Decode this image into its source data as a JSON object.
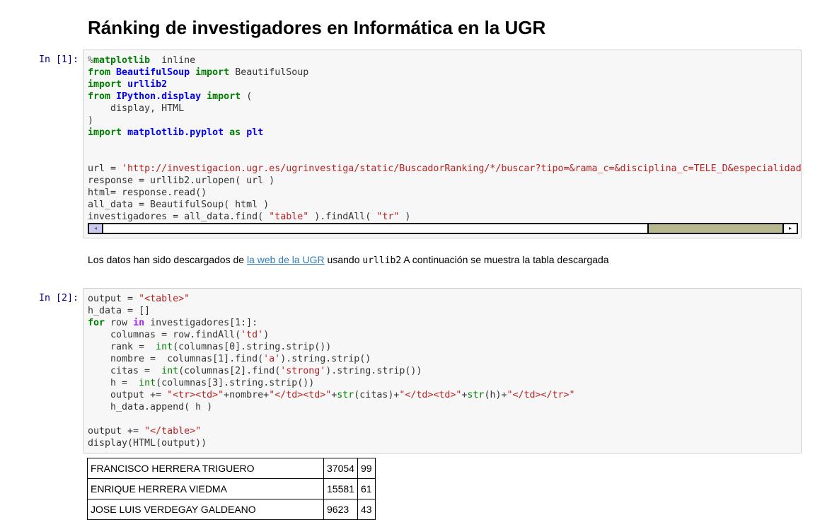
{
  "title": "Ránking de investigadores en Informática en la UGR",
  "cells": [
    {
      "prompt": "In [1]:",
      "lines": [
        [
          [
            "mg",
            "%"
          ],
          [
            "kw",
            "matplotlib"
          ],
          [
            "",
            "  inline"
          ]
        ],
        [
          [
            "kw",
            "from"
          ],
          [
            "",
            " "
          ],
          [
            "nm",
            "BeautifulSoup"
          ],
          [
            "",
            " "
          ],
          [
            "kw",
            "import"
          ],
          [
            "",
            " BeautifulSoup"
          ]
        ],
        [
          [
            "kw",
            "import"
          ],
          [
            "",
            " "
          ],
          [
            "nm",
            "urllib2"
          ]
        ],
        [
          [
            "kw",
            "from"
          ],
          [
            "",
            " "
          ],
          [
            "nm",
            "IPython.display"
          ],
          [
            "",
            " "
          ],
          [
            "kw",
            "import"
          ],
          [
            "",
            " ("
          ]
        ],
        [
          [
            "",
            "    display, HTML"
          ]
        ],
        [
          [
            "",
            ")"
          ]
        ],
        [
          [
            "kw",
            "import"
          ],
          [
            "",
            " "
          ],
          [
            "nm",
            "matplotlib.pyplot"
          ],
          [
            "",
            " "
          ],
          [
            "kw",
            "as"
          ],
          [
            "",
            " "
          ],
          [
            "nm",
            "plt"
          ]
        ],
        [],
        [],
        [
          [
            "",
            "url = "
          ],
          [
            "st",
            "'http://investigacion.ugr.es/ugrinvestiga/static/BuscadorRanking/*/buscar?tipo=&rama_c=&disciplina_c=TELE_D&especialidad"
          ]
        ],
        [
          [
            "",
            "response = urllib2.urlopen( url )"
          ]
        ],
        [
          [
            "",
            "html= response.read()"
          ]
        ],
        [
          [
            "",
            "all_data = BeautifulSoup( html )"
          ]
        ],
        [
          [
            "",
            "investigadores = all_data.find( "
          ],
          [
            "st",
            "\"table\""
          ],
          [
            "",
            " ).findAll( "
          ],
          [
            "st",
            "\"tr\""
          ],
          [
            "",
            " )"
          ]
        ]
      ]
    },
    {
      "prompt": "In [2]:",
      "lines": [
        [
          [
            "",
            "output = "
          ],
          [
            "st",
            "\"<table>\""
          ]
        ],
        [
          [
            "",
            "h_data = []"
          ]
        ],
        [
          [
            "kw",
            "for"
          ],
          [
            "",
            " row "
          ],
          [
            "ow",
            "in"
          ],
          [
            "",
            " investigadores[1:]:"
          ]
        ],
        [
          [
            "",
            "    columnas = row.findAll("
          ],
          [
            "st",
            "'td'"
          ],
          [
            "",
            ")"
          ]
        ],
        [
          [
            "",
            "    rank =  "
          ],
          [
            "bi",
            "int"
          ],
          [
            "",
            "(columnas[0].string.strip())"
          ]
        ],
        [
          [
            "",
            "    nombre =  columnas[1].find("
          ],
          [
            "st",
            "'a'"
          ],
          [
            "",
            ").string.strip()"
          ]
        ],
        [
          [
            "",
            "    citas =  "
          ],
          [
            "bi",
            "int"
          ],
          [
            "",
            "(columnas[2].find("
          ],
          [
            "st",
            "'strong'"
          ],
          [
            "",
            ").string.strip())"
          ]
        ],
        [
          [
            "",
            "    h =  "
          ],
          [
            "bi",
            "int"
          ],
          [
            "",
            "(columnas[3].string.strip())"
          ]
        ],
        [
          [
            "",
            "    output += "
          ],
          [
            "st",
            "\"<tr><td>\""
          ],
          [
            "",
            "+nombre+"
          ],
          [
            "st",
            "\"</td><td>\""
          ],
          [
            "",
            "+"
          ],
          [
            "bi",
            "str"
          ],
          [
            "",
            "(citas)+"
          ],
          [
            "st",
            "\"</td><td>\""
          ],
          [
            "",
            "+"
          ],
          [
            "bi",
            "str"
          ],
          [
            "",
            "(h)+"
          ],
          [
            "st",
            "\"</td></tr>\""
          ]
        ],
        [
          [
            "",
            "    h_data.append( h )"
          ]
        ],
        [],
        [
          [
            "",
            "output += "
          ],
          [
            "st",
            "\"</table>\""
          ]
        ],
        [
          [
            "",
            "display(HTML(output))"
          ]
        ]
      ]
    }
  ],
  "markdown": {
    "before_link": "Los datos han sido descargados de ",
    "link": "la web de la UGR",
    "after_link": " usando ",
    "code": "urllib2",
    "rest": " A continuación se muestra la tabla descargada"
  },
  "output_table": {
    "rows": [
      [
        "FRANCISCO HERRERA TRIGUERO",
        "37054",
        "99"
      ],
      [
        "ENRIQUE HERRERA VIEDMA",
        "15581",
        "61"
      ],
      [
        "JOSE LUIS VERDEGAY GALDEANO",
        "9623",
        "43"
      ]
    ]
  },
  "scrollbar": {
    "left_arrow": "◂",
    "right_arrow": "▸"
  },
  "colors": {
    "keyword": "#008000",
    "name": "#0000ff",
    "string": "#ba2121",
    "prompt": "#000080",
    "link": "#337ab7"
  }
}
